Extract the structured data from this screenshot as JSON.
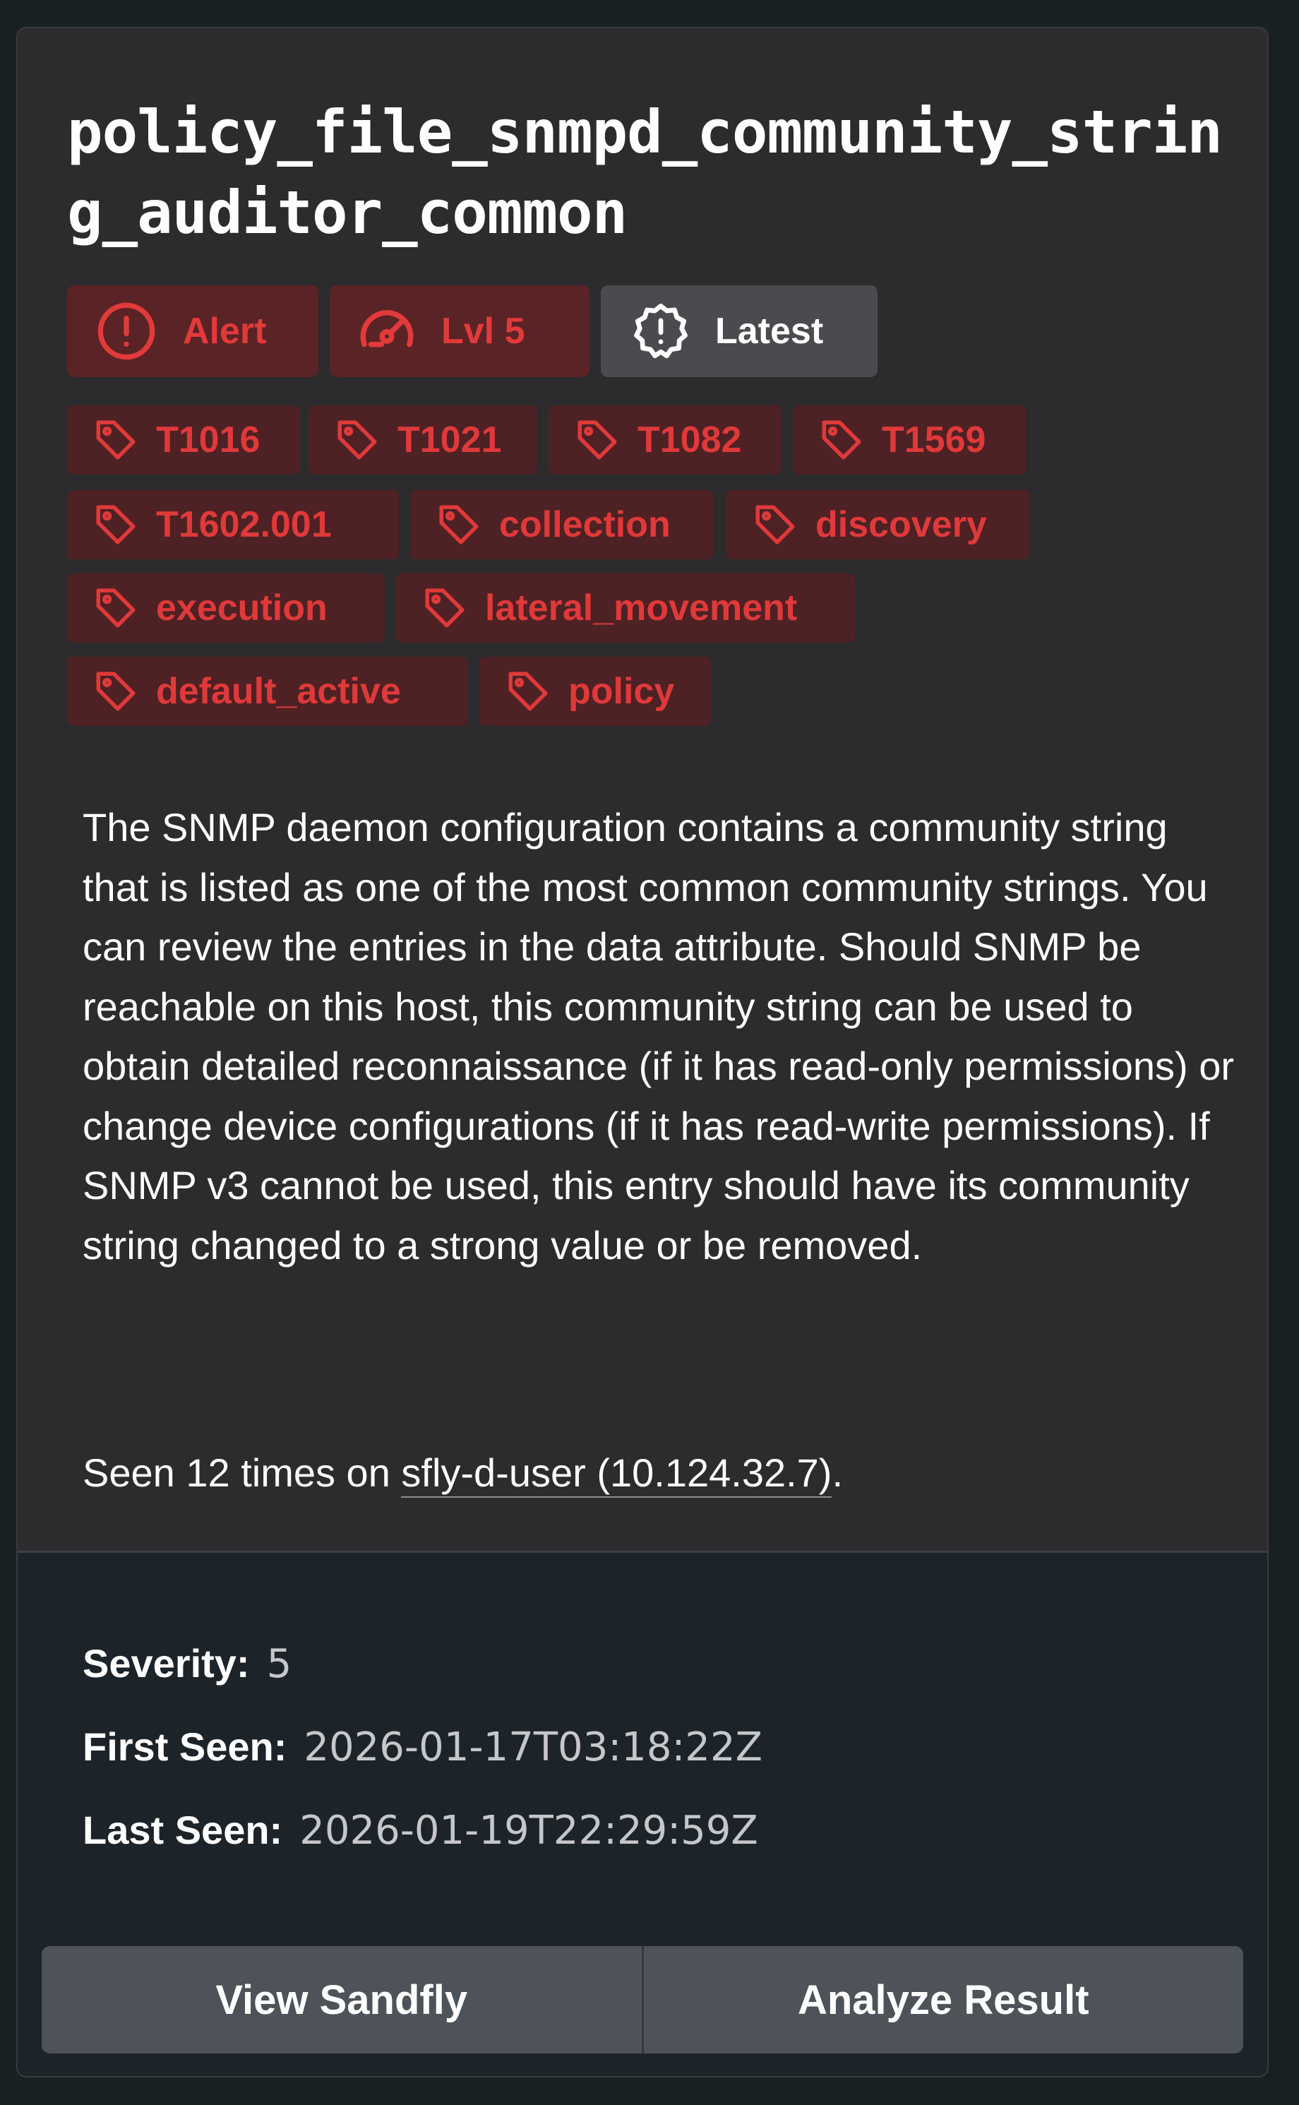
{
  "result": {
    "title": "policy_file_snmpd_community_string_auditor_common",
    "badges": {
      "alert": "Alert",
      "level": "Lvl 5",
      "latest": "Latest"
    },
    "tags": [
      "T1016",
      "T1021",
      "T1082",
      "T1569",
      "T1602.001",
      "collection",
      "discovery",
      "execution",
      "lateral_movement",
      "default_active",
      "policy"
    ],
    "description": "The SNMP daemon configuration contains a community string that is listed as one of the most common community strings. You can review the entries in the data attribute. Should SNMP be reachable on this host, this community string can be used to obtain detailed reconnaissance (if it has read-only permissions) or change device configurations (if it has read-write permissions). If SNMP v3 cannot be used, this entry should have its community string changed to a strong value or be removed.",
    "seen": {
      "prefix": "Seen 12 times on ",
      "host": "sfly-d-user (10.124.32.7)",
      "suffix": "."
    },
    "meta": {
      "severity_label": "Severity:",
      "severity_value": "5",
      "first_seen_label": "First Seen:",
      "first_seen_value": "2026-01-17T03:18:22Z",
      "last_seen_label": "Last Seen:",
      "last_seen_value": "2026-01-19T22:29:59Z"
    },
    "actions": {
      "view_sandfly": "View Sandfly",
      "analyze_result": "Analyze Result"
    }
  },
  "icons": {
    "alert": "alert-circle-icon",
    "level": "gauge-icon",
    "latest": "badge-alert-icon",
    "tag": "tag-icon"
  },
  "colors": {
    "page_background": "#192024",
    "card_background": "#2c2b2d",
    "card_footer_background": "#1d2429",
    "badge_red_background": "#5a2326",
    "tag_background": "#4e2124",
    "accent_red": "#e23a3a",
    "button_background": "#4d5358"
  }
}
